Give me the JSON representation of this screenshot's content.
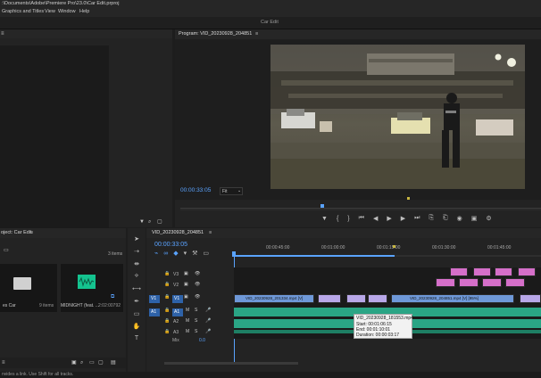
{
  "titlebar": {
    "path": ":\\Documents\\Adobe\\Premiere Pro\\23.0\\Car Edit.prproj"
  },
  "menubar": {
    "items": [
      "Graphics and Titles",
      "View",
      "Window",
      "Help"
    ]
  },
  "workspace": {
    "title": "Car Edit"
  },
  "program_monitor": {
    "tab_label": "Program: VID_20230928_204851",
    "menu_icon": "≡",
    "timecode": "00:00:33:05",
    "fit_label": "Fit",
    "fit_options": [
      "Fit"
    ],
    "controls": [
      "marker-icon",
      "in-point-icon",
      "out-point-icon",
      "go-to-in-icon",
      "step-back-icon",
      "play-icon",
      "step-forward-icon",
      "go-to-out-icon",
      "insert-icon",
      "overwrite-icon",
      "export-frame-icon",
      "comparison-icon",
      "settings-icon"
    ]
  },
  "project_panel": {
    "tab_label": "oject: Car Edit",
    "menu_icon": "≡",
    "items_count": "3 items",
    "items": [
      {
        "name": "es Car",
        "meta": "9 items",
        "type": "bin"
      },
      {
        "name": "MIDNIGHT (feat. ...",
        "meta": "2:02:00792",
        "type": "audio"
      }
    ]
  },
  "tools": {
    "icons": [
      "selection-tool-icon",
      "track-select-tool-icon",
      "ripple-edit-tool-icon",
      "razor-tool-icon",
      "slip-tool-icon",
      "pen-tool-icon",
      "rectangle-tool-icon",
      "hand-tool-icon",
      "type-tool-icon"
    ]
  },
  "timeline": {
    "tab_label": "VID_20230928_204851",
    "menu_icon": "≡",
    "timecode": "00:00:33:05",
    "ruler_labels": [
      "00:00:45:00",
      "00:01:00:00",
      "00:01:15:00",
      "00:01:30:00",
      "00:01:45:00"
    ],
    "video_tracks": [
      "V3",
      "V2",
      "V1"
    ],
    "audio_tracks": [
      "A1",
      "A2",
      "A3"
    ],
    "source_patch": [
      "V1",
      "A1"
    ],
    "mix_label": "Mix",
    "mix_value": "0.0",
    "clips": [
      {
        "label": "VID_20230928_201334.mp4 [V]",
        "track": "V1"
      },
      {
        "label": "VID_20230928_204851.mp4 [V] [95%]",
        "track": "V1"
      }
    ],
    "tooltip": {
      "title": "VID_20230928_181553.mp4",
      "start": "Start: 00:01:06:15",
      "end": "End: 00:01:10:01",
      "duration": "Duration: 00:00:03:17"
    }
  },
  "statusbar": {
    "text": "nvides a link. Use Shift for all tracks."
  }
}
